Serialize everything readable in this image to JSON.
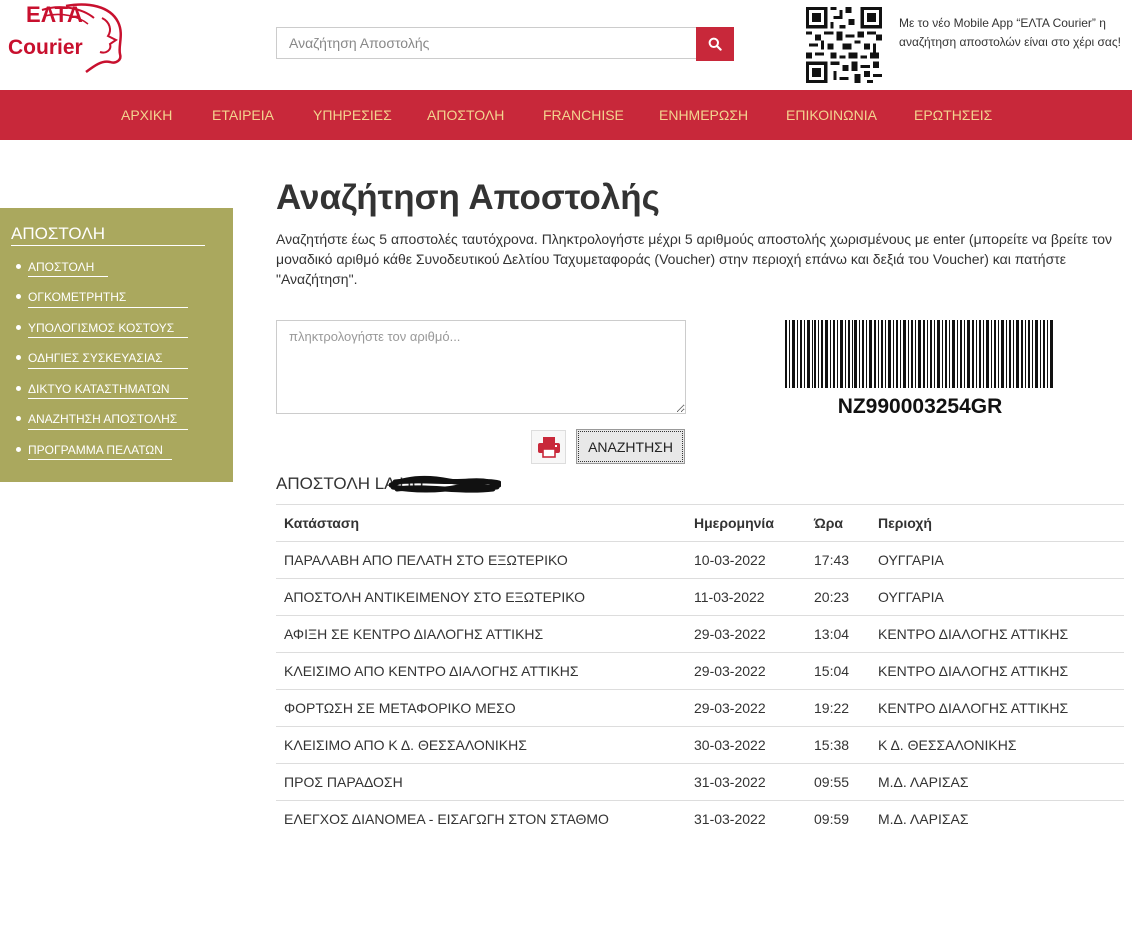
{
  "logo": {
    "line1": "ΕΛΤΑ",
    "line2": "Courier"
  },
  "search": {
    "placeholder": "Αναζήτηση Αποστολής"
  },
  "promo": {
    "text": "Με το νέο Mobile App “ΕΛΤΑ Courier” η αναζήτηση αποστολών είναι στο χέρι σας!"
  },
  "nav": {
    "items": [
      "ΑΡΧΙΚΗ",
      "ΕΤΑΙΡΕΙΑ",
      "ΥΠΗΡΕΣΙΕΣ",
      "ΑΠΟΣΤΟΛΗ",
      "FRANCHISE",
      "ΕΝΗΜΕΡΩΣΗ",
      "ΕΠΙΚΟΙΝΩΝΙΑ",
      "ΕΡΩΤΗΣΕΙΣ"
    ]
  },
  "sidebar": {
    "title": "ΑΠΟΣΤΟΛΗ",
    "items": [
      "ΑΠΟΣΤΟΛΗ",
      "ΟΓΚΟΜΕΤΡΗΤΗΣ",
      "ΥΠΟΛΟΓΙΣΜΟΣ ΚΟΣΤΟΥΣ",
      "ΟΔΗΓΙΕΣ ΣΥΣΚΕΥΑΣΙΑΣ",
      "ΔΙΚΤΥΟ ΚΑΤΑΣΤΗΜΑΤΩΝ",
      "ΑΝΑΖΗΤΗΣΗ ΑΠΟΣΤΟΛΗΣ",
      "ΠΡΟΓΡΑΜΜΑ ΠΕΛΑΤΩΝ"
    ]
  },
  "main": {
    "title": "Αναζήτηση Αποστολής",
    "description": "Αναζητήστε έως 5 αποστολές ταυτόχρονα. Πληκτρολογήστε μέχρι 5 αριθμούς αποστολής χωρισμένους με enter (μπορείτε να βρείτε τον μοναδικό αριθμό κάθε Συνοδευτικού Δελτίου Ταχυμεταφοράς (Voucher) στην περιοχή επάνω και δεξιά του Voucher) και πατήστε \"Αναζήτηση\".",
    "tracking_placeholder": "πληκτρολογήστε τον αριθμό...",
    "barcode_number": "NZ990003254GR",
    "search_button": "ΑΝΑΖΗΤΗΣΗ",
    "shipment_heading": "ΑΠΟΣΤΟΛΗ LA          HU"
  },
  "table": {
    "headers": [
      "Κατάσταση",
      "Ημερομηνία",
      "Ώρα",
      "Περιοχή"
    ],
    "rows": [
      [
        "ΠΑΡΑΛΑΒΗ ΑΠΟ ΠΕΛΑΤΗ ΣΤΟ ΕΞΩΤΕΡΙΚΟ",
        "10-03-2022",
        "17:43",
        "ΟΥΓΓΑΡΙΑ"
      ],
      [
        "ΑΠΟΣΤΟΛΗ ΑΝΤΙΚΕΙΜΕΝΟΥ ΣΤΟ ΕΞΩΤΕΡΙΚΟ",
        "11-03-2022",
        "20:23",
        "ΟΥΓΓΑΡΙΑ"
      ],
      [
        "ΑΦΙΞΗ ΣΕ ΚΕΝΤΡΟ ΔΙΑΛΟΓΗΣ ΑΤΤΙΚΗΣ",
        "29-03-2022",
        "13:04",
        "ΚΕΝΤΡΟ ΔΙΑΛΟΓΗΣ ΑΤΤΙΚΗΣ"
      ],
      [
        "ΚΛΕΙΣΙΜΟ ΑΠΟ ΚΕΝΤΡΟ ΔΙΑΛΟΓΗΣ ΑΤΤΙΚΗΣ",
        "29-03-2022",
        "15:04",
        "ΚΕΝΤΡΟ ΔΙΑΛΟΓΗΣ ΑΤΤΙΚΗΣ"
      ],
      [
        "ΦΟΡΤΩΣΗ ΣΕ ΜΕΤΑΦΟΡΙΚΟ ΜΕΣΟ",
        "29-03-2022",
        "19:22",
        "ΚΕΝΤΡΟ ΔΙΑΛΟΓΗΣ ΑΤΤΙΚΗΣ"
      ],
      [
        "ΚΛΕΙΣΙΜΟ ΑΠΟ Κ Δ. ΘΕΣΣΑΛΟΝΙΚΗΣ",
        "30-03-2022",
        "15:38",
        "Κ Δ. ΘΕΣΣΑΛΟΝΙΚΗΣ"
      ],
      [
        "ΠΡΟΣ ΠΑΡΑΔΟΣΗ",
        "31-03-2022",
        "09:55",
        "Μ.Δ. ΛΑΡΙΣΑΣ"
      ],
      [
        "ΕΛΕΓΧΟΣ ΔΙΑΝΟΜΕΑ - ΕΙΣΑΓΩΓΗ ΣΤΟΝ ΣΤΑΘΜΟ",
        "31-03-2022",
        "09:59",
        "Μ.Δ. ΛΑΡΙΣΑΣ"
      ]
    ]
  },
  "colors": {
    "brand_red": "#c8283a",
    "nav_text": "#f3d48f",
    "sidebar_bg": "#aaa85e"
  },
  "icons": [
    "search-icon",
    "qr-code",
    "print-icon",
    "barcode"
  ]
}
